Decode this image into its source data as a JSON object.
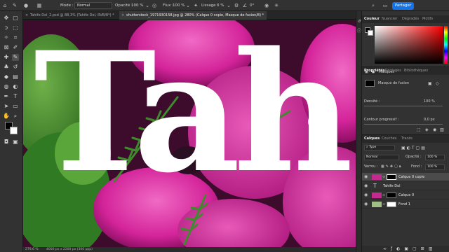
{
  "options_bar": {
    "mode_label": "Mode :",
    "mode_value": "Normal",
    "opacity_label": "Opacité :",
    "opacity_value": "100 %",
    "flow_label": "Flux :",
    "flow_value": "100 %",
    "smoothing_label": "Lissage :",
    "smoothing_value": "0 %",
    "angle_value": "0°",
    "share_label": "Partager"
  },
  "tabs": [
    {
      "label": "Tahife Dol_2.psd @ 88,3% (Tahife Dol, RVB/8*) *"
    },
    {
      "label": "shutterstock_1971930158.jpg @ 280% (Calque 0 copie, Masque de fusion/8) *"
    }
  ],
  "canvas": {
    "text": "Tah"
  },
  "statusbar": {
    "zoom": "279,6 %",
    "doc": "4000 px x 2200 px (300 ppp)"
  },
  "color_panel": {
    "tabs": [
      "Couleur",
      "Nuancier",
      "Dégradés",
      "Motifs"
    ],
    "foreground": "#000000",
    "background": "#ffffff",
    "hue_color": "#ff0000"
  },
  "properties_panel": {
    "tabs": [
      "Propriétés",
      "Réglages",
      "Bibliothèques"
    ],
    "masks_label": "Masques",
    "mask_name": "Masque de fusion",
    "density_label": "Densité :",
    "density_value": "100 %",
    "feather_label": "Contour progressif :",
    "feather_value": "0,0 px"
  },
  "layers_panel": {
    "tabs": [
      "Calques",
      "Couches",
      "Tracés"
    ],
    "filter_value": "Type",
    "blend_mode": "Normal",
    "opacity_label": "Opacité :",
    "opacity_value": "100 %",
    "lock_label": "Verrou :",
    "fill_label": "Fond :",
    "fill_value": "100 %",
    "layers": [
      {
        "name": "Calque 0 copie",
        "type": "mask",
        "selected": true
      },
      {
        "name": "Tahife Dol",
        "type": "text",
        "selected": false
      },
      {
        "name": "Calque 0",
        "type": "image",
        "selected": false
      },
      {
        "name": "Fond 1",
        "type": "fill",
        "selected": false
      }
    ]
  },
  "colors": {
    "app_bg": "#1e1e1e",
    "panel": "#323232",
    "accent": "#1473e6",
    "orchid": "#d8249b",
    "leaf": "#3f8a2c"
  }
}
